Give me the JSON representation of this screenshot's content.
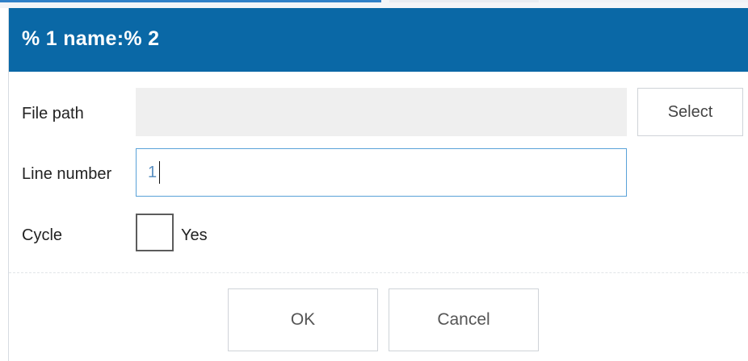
{
  "dialog": {
    "title": "% 1 name:% 2"
  },
  "form": {
    "file_path": {
      "label": "File path",
      "value": ""
    },
    "select_button": "Select",
    "line_number": {
      "label": "Line number",
      "value": "1"
    },
    "cycle": {
      "label": "Cycle",
      "checkbox_label": "Yes",
      "checked": false
    }
  },
  "footer": {
    "ok_label": "OK",
    "cancel_label": "Cancel"
  },
  "colors": {
    "titlebar": "#0a68a6",
    "focus_border": "#5aa2d8",
    "disabled_field": "#efefef"
  }
}
